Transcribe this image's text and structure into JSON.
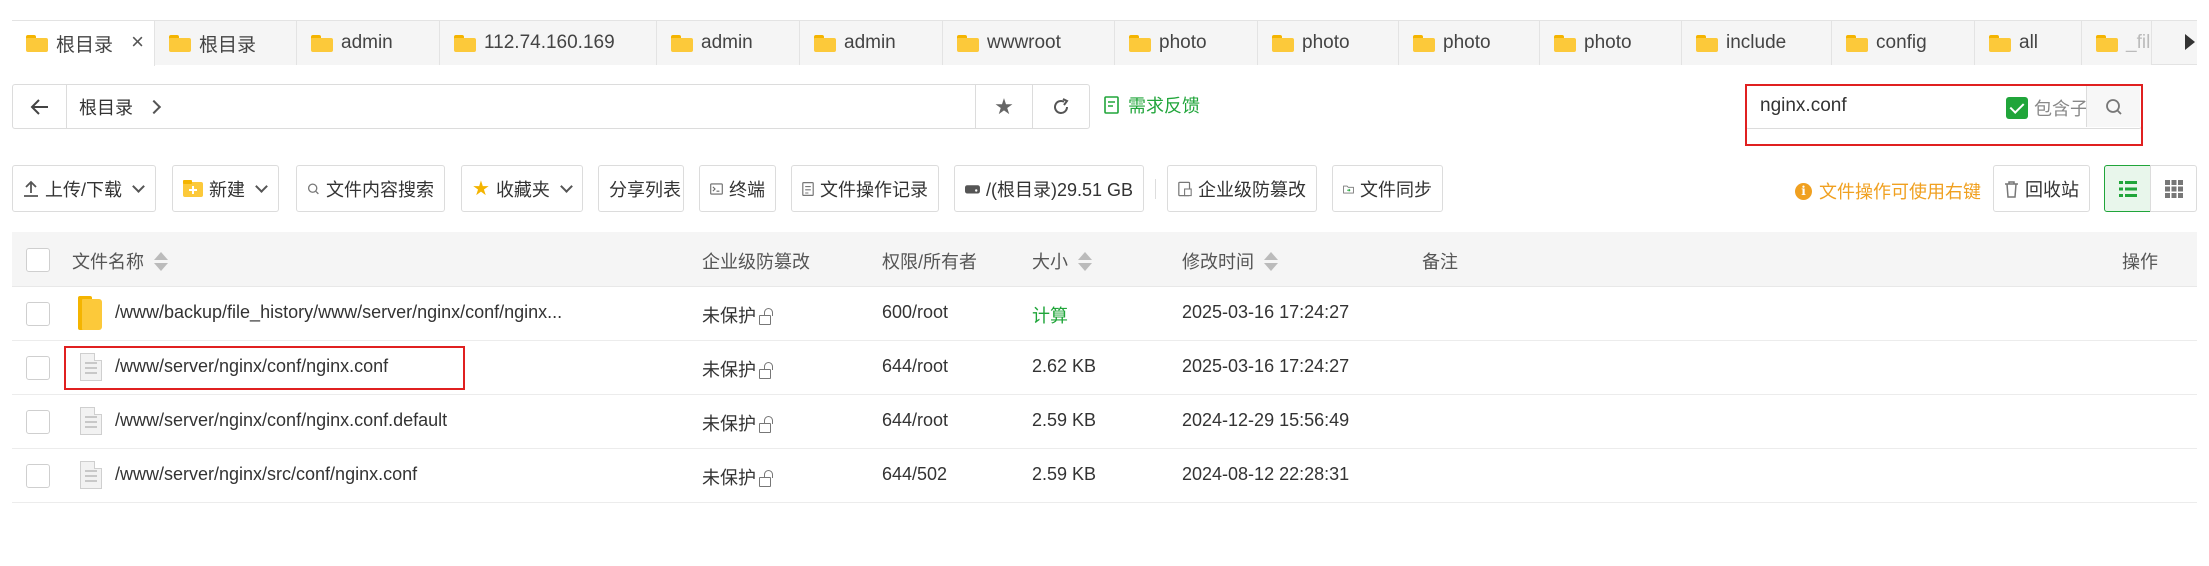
{
  "tabs": [
    {
      "label": "根目录",
      "active": true,
      "closable": true
    },
    {
      "label": "根目录"
    },
    {
      "label": "admin"
    },
    {
      "label": "112.74.160.169"
    },
    {
      "label": "admin"
    },
    {
      "label": "admin"
    },
    {
      "label": "wwwroot"
    },
    {
      "label": "photo"
    },
    {
      "label": "photo"
    },
    {
      "label": "photo"
    },
    {
      "label": "photo"
    },
    {
      "label": "include"
    },
    {
      "label": "config"
    },
    {
      "label": "all"
    },
    {
      "label": "_file"
    }
  ],
  "pathbar": {
    "crumb": "根目录"
  },
  "feedback": "需求反馈",
  "search": {
    "value": "nginx.conf",
    "include_subdirs_label": "包含子目录",
    "include_subdirs_checked": true
  },
  "toolbar": {
    "upload": "上传/下载",
    "new": "新建",
    "content_search": "文件内容搜索",
    "favorites": "收藏夹",
    "share_list": "分享列表",
    "terminal": "终端",
    "op_log": "文件操作记录",
    "disk": "/(根目录)29.51 GB",
    "tamper": "企业级防篡改",
    "sync": "文件同步",
    "tip": "文件操作可使用右键",
    "recycle": "回收站"
  },
  "columns": {
    "name": "文件名称",
    "tamper": "企业级防篡改",
    "perm": "权限/所有者",
    "size": "大小",
    "mtime": "修改时间",
    "note": "备注",
    "ops": "操作"
  },
  "rows": [
    {
      "type": "folder",
      "name": "/www/backup/file_history/www/server/nginx/conf/nginx...",
      "tamper": "未保护",
      "perm": "600/root",
      "size": "计算",
      "mtime": "2025-03-16 17:24:27"
    },
    {
      "type": "file",
      "name": "/www/server/nginx/conf/nginx.conf",
      "tamper": "未保护",
      "perm": "644/root",
      "size": "2.62 KB",
      "mtime": "2025-03-16 17:24:27"
    },
    {
      "type": "file",
      "name": "/www/server/nginx/conf/nginx.conf.default",
      "tamper": "未保护",
      "perm": "644/root",
      "size": "2.59 KB",
      "mtime": "2024-12-29 15:56:49"
    },
    {
      "type": "file",
      "name": "/www/server/nginx/src/conf/nginx.conf",
      "tamper": "未保护",
      "perm": "644/502",
      "size": "2.59 KB",
      "mtime": "2024-08-12 22:28:31"
    }
  ],
  "colors": {
    "accent": "#20a53a",
    "highlight": "#e02020",
    "tip": "#f0a020",
    "folder": "#fcc93a"
  }
}
